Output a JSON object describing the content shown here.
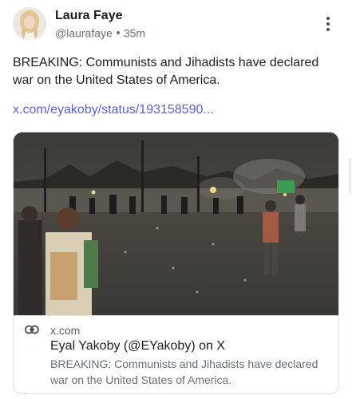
{
  "author": {
    "name": "Laura Faye",
    "handle": "@laurafaye",
    "time": "35m",
    "avatar_icon": "profile-photo"
  },
  "menu": {
    "icon": "more-vertical-icon"
  },
  "post": {
    "text": "BREAKING: Communists and Jihadists have declared war on the United States of America.",
    "link": "x.com/eyakoby/status/193158590..."
  },
  "card": {
    "domain": "x.com",
    "title": "Eyal Yakoby (@EYakoby) on X",
    "description": "BREAKING: Communists and Jihadists have declared war on the United States of America.",
    "link_icon": "link-icon"
  },
  "colors": {
    "link": "#5b5ee0",
    "muted": "#66707a",
    "border": "#dcdfe4"
  }
}
